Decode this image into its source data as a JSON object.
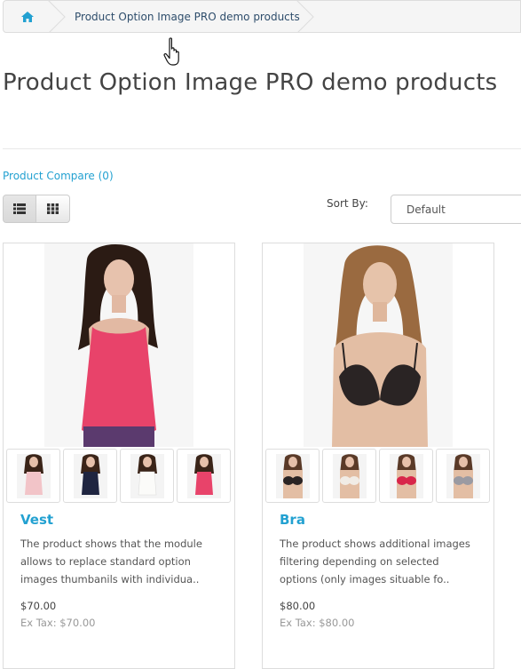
{
  "breadcrumb": {
    "home_icon": "home-icon",
    "current": "Product Option Image PRO demo products"
  },
  "page": {
    "title": "Product Option Image PRO demo products",
    "compare_link": "Product Compare (0)",
    "sort_label": "Sort By:",
    "sort_value": "Default",
    "view_list_icon": "list-icon",
    "view_grid_icon": "grid-icon"
  },
  "products": [
    {
      "name": "Vest",
      "description": "The product shows that the module allows to replace standard option images thumbanils with individua..",
      "price": "$70.00",
      "ex_tax": "Ex Tax: $70.00",
      "main_color": "#e8436a",
      "thumb_colors": [
        "#f2c4c8",
        "#1f2540",
        "#f4f4f2",
        "#e8436a"
      ]
    },
    {
      "name": "Bra",
      "description": "The product shows additional images filtering depending on selected options (only images situable fo..",
      "price": "$80.00",
      "ex_tax": "Ex Tax: $80.00",
      "main_color": "#2a2424",
      "thumb_colors": [
        "#2a2424",
        "#f1ece6",
        "#d8264a",
        "#9a9aa2"
      ]
    }
  ]
}
